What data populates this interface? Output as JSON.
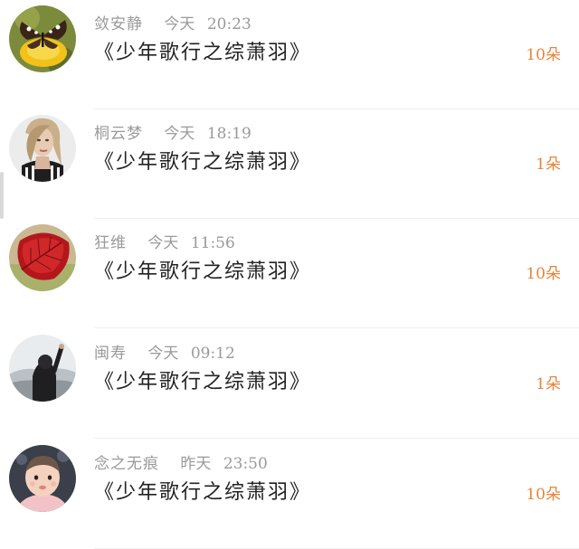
{
  "items": [
    {
      "name": "敛安静",
      "day": "今天",
      "time": "20:23",
      "title": "《少年歌行之综萧羽》",
      "count": "10朵"
    },
    {
      "name": "桐云梦",
      "day": "今天",
      "time": "18:19",
      "title": "《少年歌行之综萧羽》",
      "count": "1朵"
    },
    {
      "name": "狂维",
      "day": "今天",
      "time": "11:56",
      "title": "《少年歌行之综萧羽》",
      "count": "10朵"
    },
    {
      "name": "闽寿",
      "day": "今天",
      "time": "09:12",
      "title": "《少年歌行之综萧羽》",
      "count": "1朵"
    },
    {
      "name": "念之无痕",
      "day": "昨天",
      "time": "23:50",
      "title": "《少年歌行之综萧羽》",
      "count": "10朵"
    }
  ],
  "avatars": [
    "butterfly-flower-avatar",
    "woman-portrait-avatar",
    "red-leaf-avatar",
    "girl-back-view-avatar",
    "baby-avatar"
  ],
  "colors": {
    "count": "#e8833a",
    "meta": "#9a9a9a",
    "title": "#222222"
  }
}
